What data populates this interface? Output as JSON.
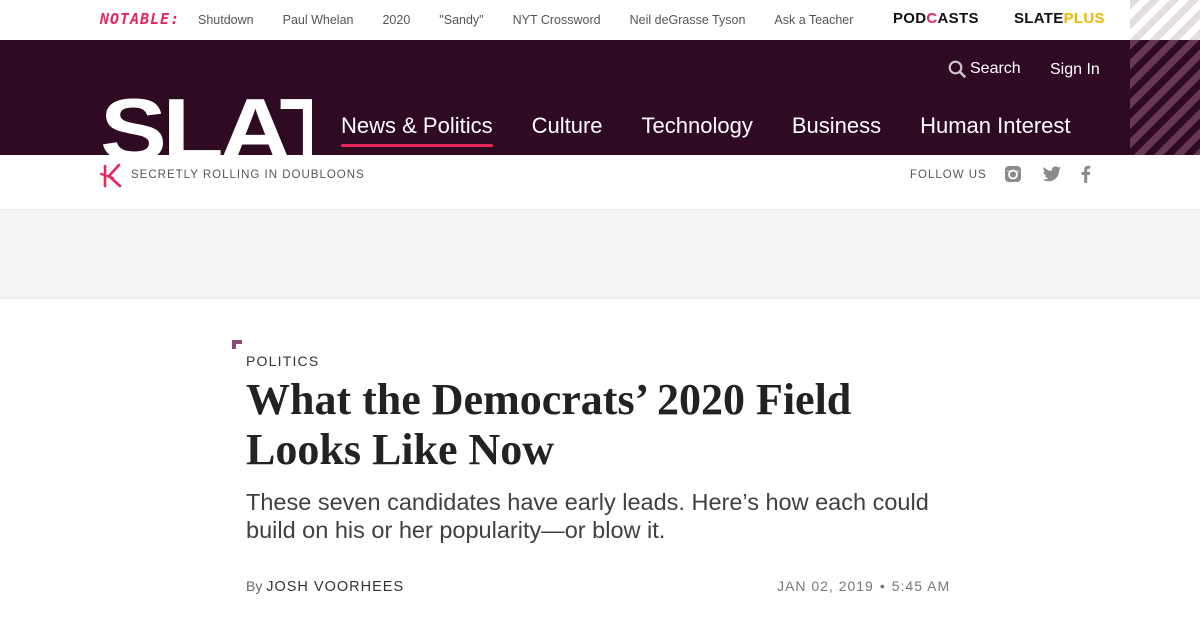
{
  "notable": {
    "logo": "NOTABLE:",
    "links": [
      "Shutdown",
      "Paul Whelan",
      "2020",
      "\"Sandy\"",
      "NYT Crossword",
      "Neil deGrasse Tyson",
      "Ask a Teacher"
    ]
  },
  "promos": {
    "podcasts": {
      "before": "POD",
      "mark": "C",
      "after": "ASTS"
    },
    "slateplus": {
      "main": "SLATE",
      "accent": "PLUS"
    }
  },
  "header": {
    "search_label": "Search",
    "signin_label": "Sign In",
    "logo": "SLATE",
    "nav": [
      "News & Politics",
      "Culture",
      "Technology",
      "Business",
      "Human Interest"
    ],
    "active_nav": "News & Politics"
  },
  "tagline": {
    "text": "SECRETLY ROLLING IN DOUBLOONS",
    "follow_label": "FOLLOW US",
    "social_icons": [
      "instagram-icon",
      "twitter-icon",
      "facebook-icon"
    ]
  },
  "article": {
    "kicker": "POLITICS",
    "headline": "What the Democrats’ 2020 Field Looks Like Now",
    "dek": "These seven candidates have early leads. Here’s how each could build on his or her popularity—or blow it.",
    "by_prefix": "By",
    "author": "JOSH VOORHEES",
    "date": "JAN 02, 2019",
    "separator": "•",
    "time": "5:45 AM"
  },
  "colors": {
    "header_bg": "#2e0a23",
    "accent_pink": "#e8265e",
    "plus_yellow": "#f0b500"
  }
}
